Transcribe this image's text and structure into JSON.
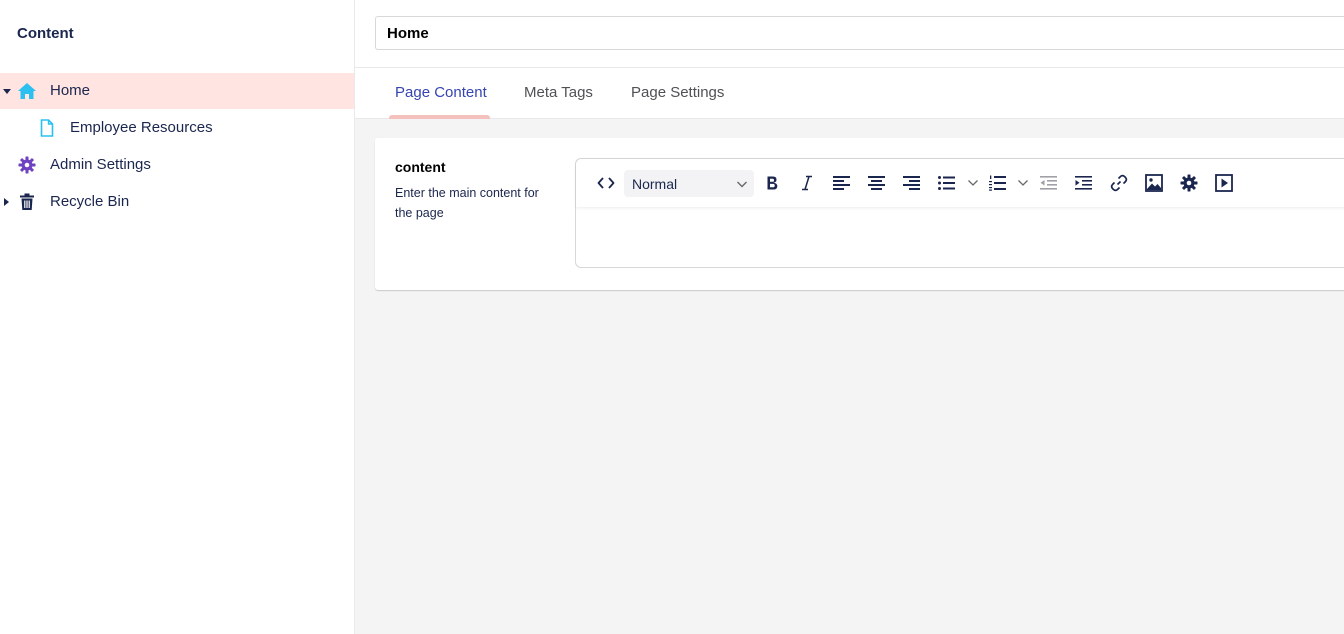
{
  "sidebar": {
    "title": "Content",
    "items": [
      {
        "label": "Home",
        "icon": "home-icon",
        "expanded": true,
        "active": true
      },
      {
        "label": "Employee Resources",
        "icon": "document-icon",
        "child": true
      },
      {
        "label": "Admin Settings",
        "icon": "gear-icon"
      },
      {
        "label": "Recycle Bin",
        "icon": "trash-icon",
        "expanded": false
      }
    ]
  },
  "header": {
    "name_value": "Home"
  },
  "tabs": [
    {
      "label": "Page Content",
      "active": true
    },
    {
      "label": "Meta Tags"
    },
    {
      "label": "Page Settings"
    }
  ],
  "property": {
    "label": "content",
    "description": "Enter the main content for the page"
  },
  "editor": {
    "format_value": "Normal",
    "toolbar_icons": [
      "code-icon",
      "bold-icon",
      "italic-icon",
      "align-left-icon",
      "align-center-icon",
      "align-right-icon",
      "bullet-list-icon",
      "numbered-list-icon",
      "outdent-icon",
      "indent-icon",
      "link-icon",
      "image-icon",
      "gear-icon",
      "media-icon"
    ]
  },
  "colors": {
    "accent": "#3544b1",
    "active_row": "#ffe4e1",
    "home_icon": "#2bc0f0",
    "admin_icon": "#6f42c1",
    "tab_underline": "#f5c1bc"
  }
}
